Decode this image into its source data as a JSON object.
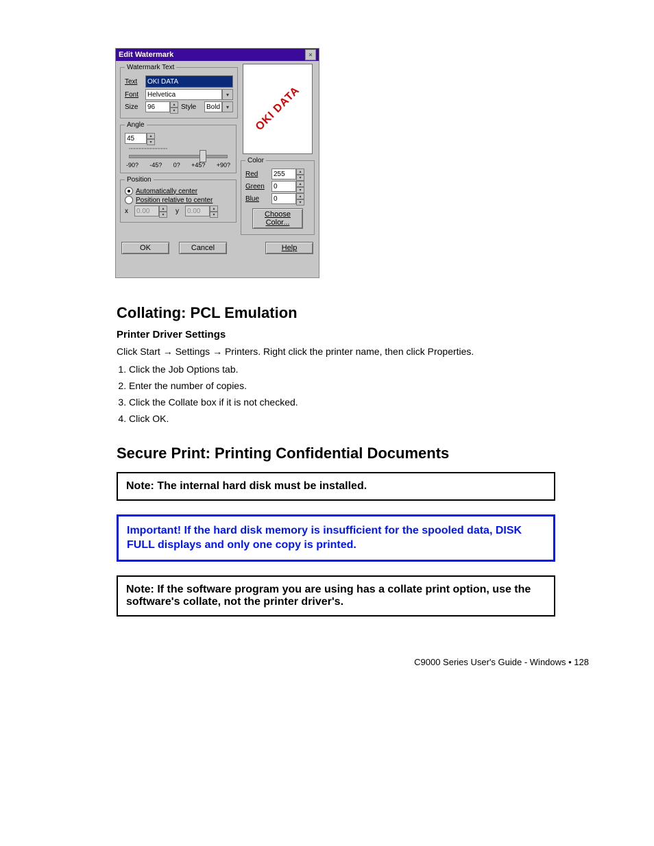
{
  "dialog": {
    "title": "Edit Watermark",
    "groups": {
      "watermark_text": {
        "legend": "Watermark Text",
        "text_label": "Text",
        "text_value": "OKI DATA",
        "font_label": "Font",
        "font_value": "Helvetica",
        "size_label": "Size",
        "size_value": "96",
        "style_label": "Style",
        "style_value": "Bold"
      },
      "angle": {
        "legend": "Angle",
        "value": "45",
        "marks": [
          "-90?",
          "-45?",
          "0?",
          "+45?",
          "+90?"
        ]
      },
      "position": {
        "legend": "Position",
        "opt_auto": "Automatically center",
        "opt_rel": "Position relative to center",
        "x_label": "x",
        "x_value": "0.00",
        "y_label": "y",
        "y_value": "0.00"
      },
      "color": {
        "legend": "Color",
        "red_label": "Red",
        "red_value": "255",
        "green_label": "Green",
        "green_value": "0",
        "blue_label": "Blue",
        "blue_value": "0",
        "choose": "Choose Color..."
      },
      "preview_text": "OKI DATA"
    },
    "buttons": {
      "ok": "OK",
      "cancel": "Cancel",
      "help": "Help"
    },
    "close_glyph": "×"
  },
  "document": {
    "section_title": "Collating: PCL Emulation",
    "subhead": "Printer Driver Settings",
    "path_prefix": "Click Start ",
    "path_mid1": " Settings ",
    "path_mid2": " Printers. ",
    "path_suffix": "Right click the printer name, then click Properties.",
    "steps": [
      "Click the Job Options tab.",
      "Enter the number of copies.",
      "Click the Collate box if it is not checked.",
      "Click OK."
    ],
    "section_title2": "Secure Print: Printing Confidential Documents",
    "note_box": "Note:   The internal hard disk must be installed.",
    "important_box": "Important!  If the hard disk memory is insufficient for the spooled data, DISK FULL displays and only one copy is printed.",
    "note_box2": "Note:  If the software program you are using has a collate print option, use the software's collate, not the printer driver's."
  },
  "footer": "C9000 Series User's Guide - Windows  •  128"
}
